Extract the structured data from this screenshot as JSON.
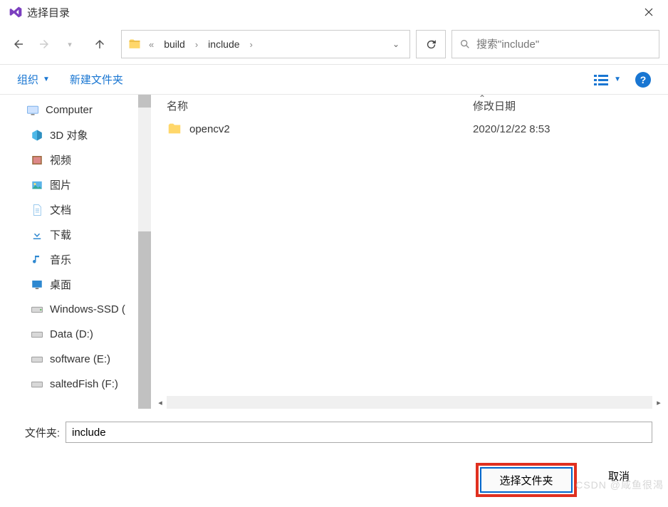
{
  "window": {
    "title": "选择目录"
  },
  "breadcrumb": {
    "parts": [
      "build",
      "include"
    ]
  },
  "search": {
    "placeholder": "搜索\"include\""
  },
  "toolbar": {
    "organize": "组织",
    "new_folder": "新建文件夹"
  },
  "sidebar": {
    "root": "Computer",
    "items": [
      {
        "label": "3D 对象",
        "icon": "cube"
      },
      {
        "label": "视频",
        "icon": "video"
      },
      {
        "label": "图片",
        "icon": "picture"
      },
      {
        "label": "文档",
        "icon": "document"
      },
      {
        "label": "下载",
        "icon": "download"
      },
      {
        "label": "音乐",
        "icon": "music"
      },
      {
        "label": "桌面",
        "icon": "desktop"
      },
      {
        "label": "Windows-SSD (",
        "icon": "drive"
      },
      {
        "label": "Data (D:)",
        "icon": "drive"
      },
      {
        "label": "software (E:)",
        "icon": "drive"
      },
      {
        "label": "saltedFish (F:)",
        "icon": "drive"
      }
    ]
  },
  "filelist": {
    "columns": {
      "name": "名称",
      "date": "修改日期"
    },
    "rows": [
      {
        "name": "opencv2",
        "date": "2020/12/22 8:53",
        "type": "folder"
      }
    ]
  },
  "footer": {
    "folder_label": "文件夹:",
    "folder_value": "include",
    "select_button": "选择文件夹",
    "cancel_button": "取消"
  },
  "watermark": "CSDN @咸鱼很渴"
}
